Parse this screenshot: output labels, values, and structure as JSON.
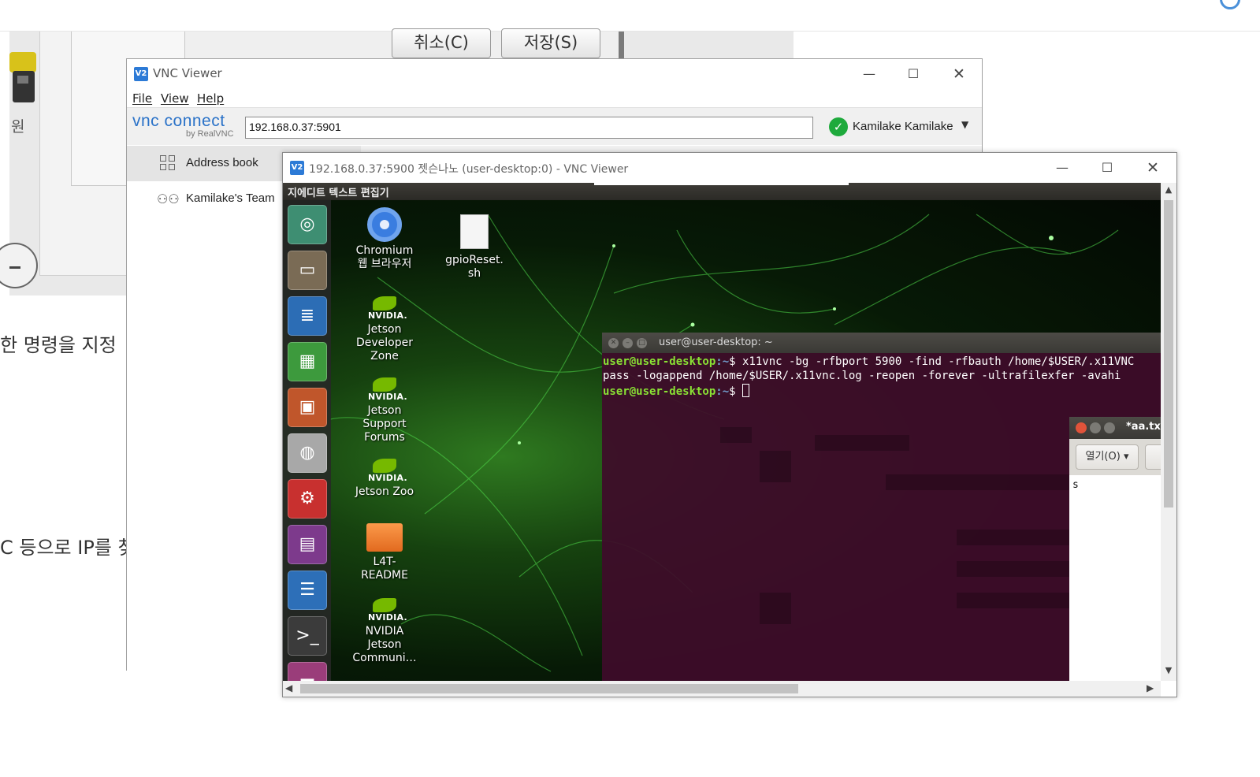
{
  "background": {
    "dialog_buttons": {
      "cancel": "취소(C)",
      "save": "저장(S)"
    },
    "side_label": "원",
    "text_line_1": "한 명령을 지정",
    "text_line_2": "C 등으로 IP를 찾"
  },
  "vnc_viewer": {
    "title": "VNC Viewer",
    "icon_text": "V2",
    "menu": {
      "file": "File",
      "view": "View",
      "help": "Help"
    },
    "brand": {
      "logo": "vnc connect",
      "sub": "by RealVNC"
    },
    "address": {
      "value": "192.168.0.37:5901"
    },
    "account": {
      "name": "Kamilake Kamilake"
    },
    "sidebar": {
      "items": [
        {
          "label": "Address book"
        },
        {
          "label": "Kamilake's Team"
        }
      ]
    },
    "window_controls": {
      "minimize": "—",
      "maximize": "☐",
      "close": "✕"
    }
  },
  "session": {
    "title": "192.168.0.37:5900 젯슨나노 (user-desktop:0) - VNC Viewer",
    "remote": {
      "active_app_title": "지에디트 텍스트 편집기",
      "launcher": [
        {
          "name": "ubuntu-dash-icon",
          "glyph": "◎",
          "color": "#3e8e72"
        },
        {
          "name": "files-icon",
          "glyph": "▭",
          "color": "#7a6b55"
        },
        {
          "name": "writer-icon",
          "glyph": "≣",
          "color": "#2c6db5"
        },
        {
          "name": "calc-icon",
          "glyph": "▦",
          "color": "#3d9a3d"
        },
        {
          "name": "impress-icon",
          "glyph": "▣",
          "color": "#c0562b"
        },
        {
          "name": "software-center-icon",
          "glyph": "◍",
          "color": "#a8a8a8"
        },
        {
          "name": "settings-icon",
          "glyph": "⚙",
          "color": "#c8302f"
        },
        {
          "name": "desktop-sharing-icon",
          "glyph": "▤",
          "color": "#7d3a8c"
        },
        {
          "name": "text-editor-icon",
          "glyph": "☰",
          "color": "#2d6fb8"
        },
        {
          "name": "terminal-icon",
          "glyph": ">_",
          "color": "#3b3b3b"
        },
        {
          "name": "presentation-icon",
          "glyph": "▬",
          "color": "#9a3d7a"
        }
      ],
      "desktop_icons": {
        "chromium": "Chromium\n웹 브라우저",
        "gpio": "gpioReset.\nsh",
        "nv_dev_zone": "Jetson\nDeveloper\nZone",
        "nv_forums": "Jetson\nSupport\nForums",
        "nv_zoo": "Jetson Zoo",
        "l4t": "L4T-\nREADME",
        "nv_community": "NVIDIA\nJetson\nCommuni…",
        "nvidia_text": "NVIDIA."
      },
      "terminal": {
        "title": "user@user-desktop: ~",
        "prompt_user": "user@user-desktop",
        "prompt_path": ":~",
        "prompt_symbol": "$ ",
        "command_line1": "x11vnc -bg -rfbport 5900 -find -rfbauth /home/$USER/.x11VNC",
        "command_line2": "pass -logappend /home/$USER/.x11vnc.log -reopen -forever -ultrafilexfer -avahi"
      },
      "gedit": {
        "title": "*aa.tx",
        "open_button": "열기(O) ▾",
        "content": "s"
      }
    }
  }
}
